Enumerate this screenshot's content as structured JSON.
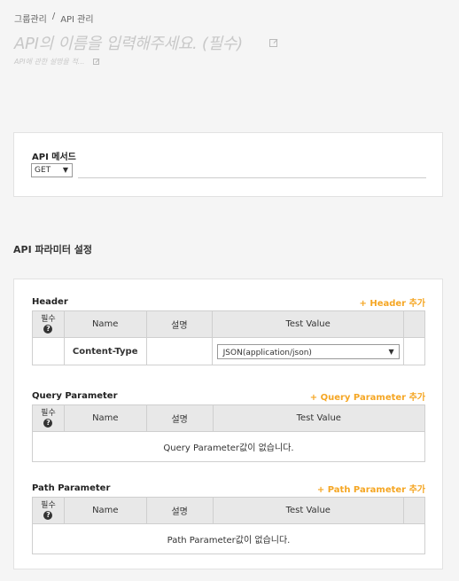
{
  "breadcrumb": {
    "parent": "그룹관리",
    "separator": "/",
    "current": "API 관리"
  },
  "api": {
    "name_placeholder": "API의 이름을 입력해주세요. (필수)",
    "description_placeholder": "API에 관한 설명을 적..."
  },
  "method": {
    "label": "API 메서드",
    "selected": "GET"
  },
  "params": {
    "section_title": "API 파라미터 설정",
    "columns": {
      "required": "필수",
      "help": "?",
      "name": "Name",
      "desc": "설명",
      "test_value": "Test Value"
    },
    "header": {
      "title": "Header",
      "add_label": "+ Header 추가",
      "rows": [
        {
          "name": "Content-Type",
          "desc": "",
          "test_value": "JSON(application/json)"
        }
      ]
    },
    "query": {
      "title": "Query Parameter",
      "add_label": "+ Query Parameter 추가",
      "empty": "Query Parameter값이 없습니다."
    },
    "path": {
      "title": "Path Parameter",
      "add_label": "+ Path Parameter 추가",
      "empty": "Path Parameter값이 없습니다."
    }
  }
}
